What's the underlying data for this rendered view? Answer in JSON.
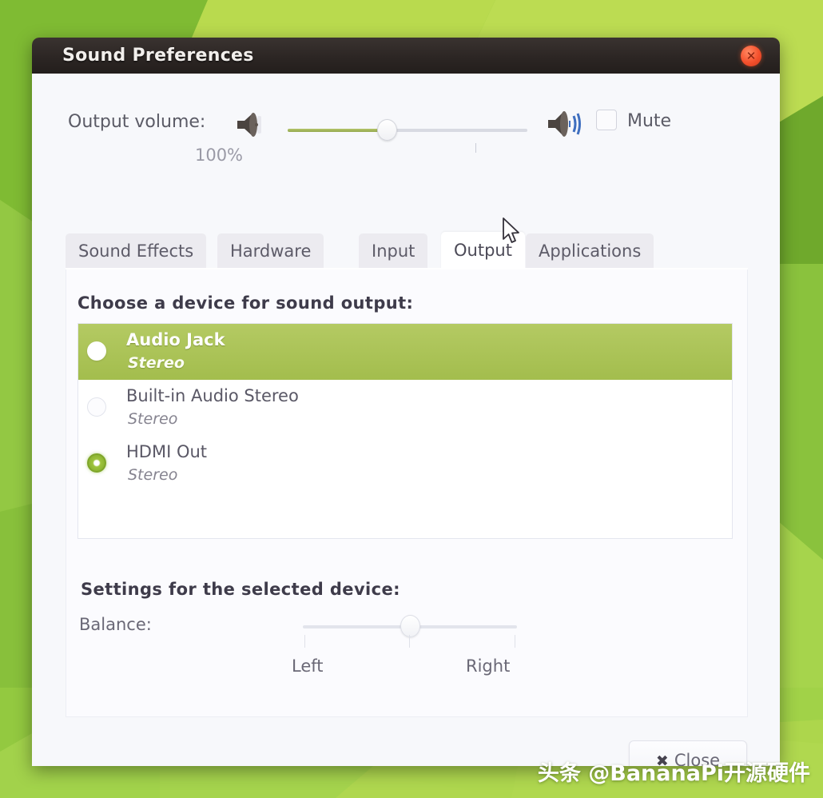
{
  "window": {
    "title": "Sound Preferences",
    "close_icon": "close-circle-icon"
  },
  "volume": {
    "label": "Output volume:",
    "low_speaker_icon": "speaker-low-icon",
    "high_speaker_icon": "speaker-high-icon",
    "percent": "100%",
    "slider_value": 41,
    "mute_label": "Mute",
    "mute_checked": false
  },
  "tabs": [
    {
      "label": "Sound Effects",
      "active": false
    },
    {
      "label": "Hardware",
      "active": false
    },
    {
      "label": "Input",
      "active": false
    },
    {
      "label": "Output",
      "active": true
    },
    {
      "label": "Applications",
      "active": false
    }
  ],
  "output_panel": {
    "choose_label": "Choose a device for sound output:",
    "devices": [
      {
        "name": "Audio Jack",
        "profile": "Stereo",
        "selected": false,
        "highlighted": true
      },
      {
        "name": "Built-in Audio Stereo",
        "profile": "Stereo",
        "selected": false,
        "highlighted": false
      },
      {
        "name": "HDMI Out",
        "profile": "Stereo",
        "selected": true,
        "highlighted": false
      }
    ],
    "settings_label": "Settings for the selected device:",
    "balance_label": "Balance:",
    "balance_left": "Left",
    "balance_right": "Right",
    "balance_value": 50
  },
  "footer": {
    "close_label": "Close",
    "close_glyph": "✖"
  },
  "cursor": {
    "icon": "arrow-pointer-icon"
  },
  "watermark": {
    "text": "头条 @BananaPi开源硬件"
  },
  "colors": {
    "accent_green": "#a3bd4d",
    "titlebar": "#2c2624",
    "close_red": "#f4502c",
    "desktop_green": "#8cc63f"
  }
}
